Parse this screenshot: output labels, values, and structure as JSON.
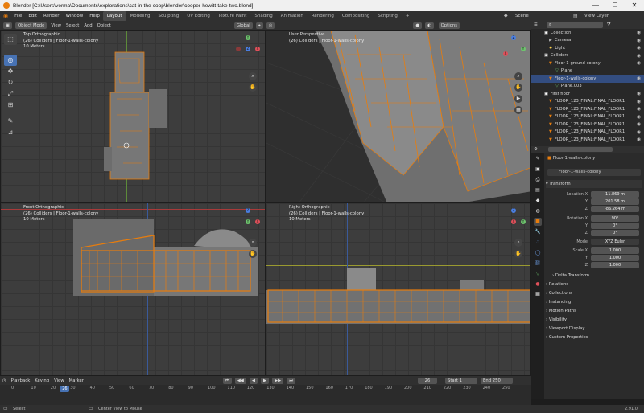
{
  "window": {
    "title": "Blender [C:\\Users\\verma\\Documents\\explorations\\cat-in-the-coop\\blender\\cooper-hewitt-take-two.blend]",
    "minimize": "—",
    "maximize": "☐",
    "close": "✕"
  },
  "menu": [
    "File",
    "Edit",
    "Render",
    "Window",
    "Help"
  ],
  "workspaces": [
    "Layout",
    "Modeling",
    "Sculpting",
    "UV Editing",
    "Texture Paint",
    "Shading",
    "Animation",
    "Rendering",
    "Compositing",
    "Scripting",
    "+"
  ],
  "scene_label": "Scene",
  "view_layer_label": "View Layer",
  "viewport_header": {
    "mode": "Object Mode",
    "menus": [
      "View",
      "Select",
      "Add",
      "Object"
    ],
    "transform": "Global",
    "options": "Options"
  },
  "viewports": {
    "top_left": {
      "title": "Top Orthographic",
      "line2": "(26) Colliders | Floor-1-walls-colony",
      "line3": "10 Meters"
    },
    "top_right": {
      "title": "User Perspective",
      "line2": "(26) Colliders | Floor-1-walls-colony"
    },
    "bottom_left": {
      "title": "Front Orthographic",
      "line2": "(26) Colliders | Floor-1-walls-colony",
      "line3": "10 Meters"
    },
    "bottom_right": {
      "title": "Right Orthographic",
      "line2": "(26) Colliders | Floor-1-walls-colony",
      "line3": "10 Meters"
    }
  },
  "outliner": {
    "rows": [
      {
        "label": "Collection",
        "icon": "collection-icon"
      },
      {
        "label": "Camera",
        "icon": "camera-icon"
      },
      {
        "label": "Light",
        "icon": "light-icon"
      },
      {
        "label": "Colliders",
        "icon": "collection-icon"
      },
      {
        "label": "Floor-1-ground-colony",
        "icon": "mesh-icon"
      },
      {
        "label": "Plane",
        "icon": "plane-icon"
      },
      {
        "label": "Floor-1-walls-colony",
        "icon": "mesh-icon"
      },
      {
        "label": "Plane.003",
        "icon": "plane-icon"
      },
      {
        "label": "First floor",
        "icon": "collection-icon"
      },
      {
        "label": "FLOOR_123_FINAL:FINAL_FLOOR1",
        "icon": "mesh-icon"
      },
      {
        "label": "FLOOR_123_FINAL:FINAL_FLOOR1",
        "icon": "mesh-icon"
      },
      {
        "label": "FLOOR_123_FINAL:FINAL_FLOOR1",
        "icon": "mesh-icon"
      },
      {
        "label": "FLOOR_123_FINAL:FINAL_FLOOR1",
        "icon": "mesh-icon"
      },
      {
        "label": "FLOOR_123_FINAL:FINAL_FLOOR1",
        "icon": "mesh-icon"
      },
      {
        "label": "FLOOR_123_FINAL:FINAL_FLOOR1",
        "icon": "mesh-icon"
      }
    ],
    "selected_row": "Floor-1-walls-colony"
  },
  "properties": {
    "object_name_path": "Floor-1-walls-colony",
    "object_name": "Floor-1-walls-colony",
    "transform_header": "Transform",
    "location": {
      "label": "Location X",
      "x": "11.869 m",
      "y": "201.58 m",
      "z": "-86.264 m"
    },
    "rotation": {
      "label": "Rotation X",
      "x": "90°",
      "y": "0°",
      "z": "0°"
    },
    "mode": {
      "label": "Mode",
      "value": "XYZ Euler"
    },
    "scale": {
      "label": "Scale X",
      "x": "1.000",
      "y": "1.000",
      "z": "1.000"
    },
    "axis_y": "Y",
    "axis_z": "Z",
    "sections": [
      "Delta Transform",
      "Relations",
      "Collections",
      "Instancing",
      "Motion Paths",
      "Visibility",
      "Viewport Display",
      "Custom Properties"
    ]
  },
  "timeline": {
    "menus": [
      "Playback",
      "Keying",
      "View",
      "Marker"
    ],
    "current_frame": "26",
    "start_label": "Start",
    "start": "1",
    "end_label": "End",
    "end": "250",
    "ticks": [
      "0",
      "10",
      "20",
      "30",
      "40",
      "50",
      "60",
      "70",
      "80",
      "90",
      "100",
      "110",
      "120",
      "130",
      "140",
      "150",
      "160",
      "170",
      "180",
      "190",
      "200",
      "210",
      "220",
      "230",
      "240",
      "250"
    ],
    "playhead": "26"
  },
  "status": {
    "left": "Select",
    "middle": "Center View to Mouse",
    "version": "2.91.0"
  },
  "colors": {
    "accent_blue": "#4772b3",
    "selection_orange": "#e87d0d",
    "viewport_bg": "#3d3d3d"
  }
}
